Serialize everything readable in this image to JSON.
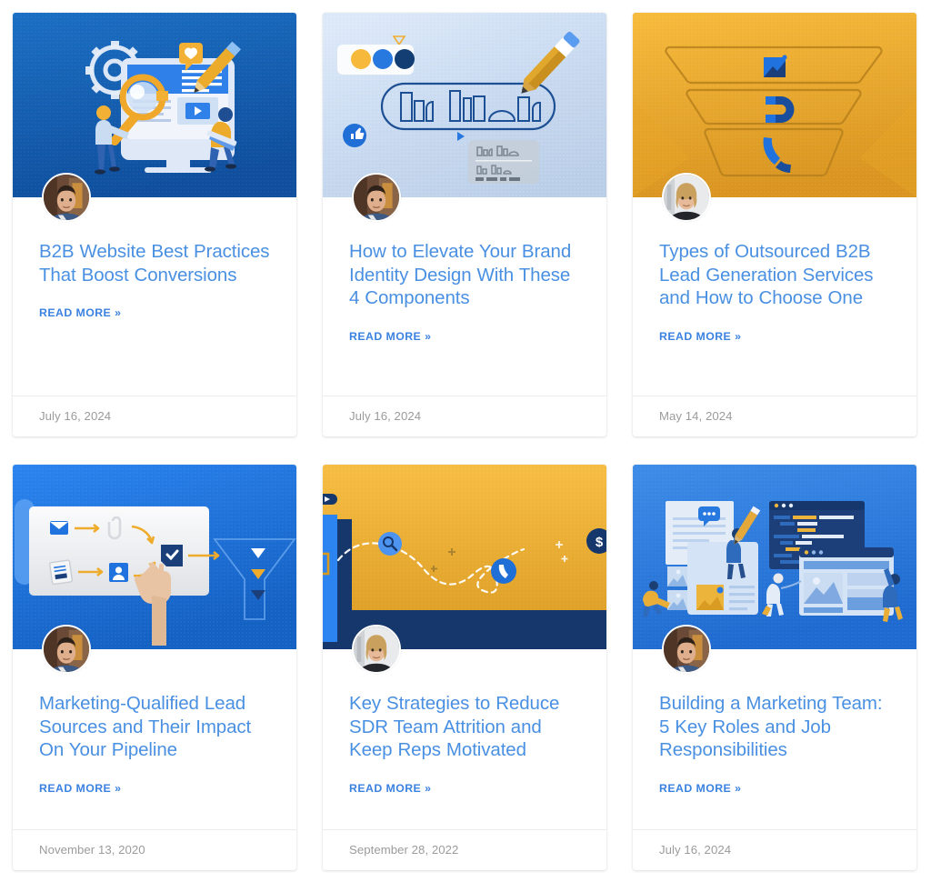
{
  "page": {
    "layout": "blog-post-card-grid",
    "columns": 3,
    "rows": 2,
    "background_color": "#ffffff",
    "title_color": "#4a90e2",
    "link_color": "#3b82e0",
    "date_color": "#9b9b9b",
    "divider_color": "#ececec"
  },
  "common": {
    "read_more_label": "READ MORE",
    "read_more_chevron": "»"
  },
  "cards": [
    {
      "id": "b2b-website-best-practices",
      "title": "B2B Website Best Practices That Boost Conversions",
      "read_more_label": "READ MORE",
      "read_more_chevron": "»",
      "date": "July 16, 2024",
      "author_avatar": "man-in-plaid-shirt-avatar",
      "thumbnail": "website-analysis-illustration",
      "thumbnail_bg": "#1464b4",
      "thumbnail_accent": "#f0ab2e"
    },
    {
      "id": "brand-identity-design",
      "title": "How to Elevate Your Brand Identity Design With These 4 Components",
      "read_more_label": "READ MORE",
      "read_more_chevron": "»",
      "date": "July 16, 2024",
      "author_avatar": "man-in-plaid-shirt-avatar",
      "thumbnail": "brand-identity-palette-illustration",
      "thumbnail_bg": "#cfe0f4",
      "thumbnail_accent": "#f2b134"
    },
    {
      "id": "outsourced-lead-generation",
      "title": "Types of Outsourced B2B Lead Generation Services and How to Choose One",
      "read_more_label": "READ MORE",
      "read_more_chevron": "»",
      "date": "May 14, 2024",
      "author_avatar": "blonde-woman-avatar",
      "thumbnail": "sales-funnel-illustration",
      "thumbnail_bg": "#f5b62e",
      "thumbnail_accent": "#1a68d8"
    },
    {
      "id": "marketing-qualified-lead-sources",
      "title": "Marketing-Qualified Lead Sources and Their Impact On Your Pipeline",
      "read_more_label": "READ MORE",
      "read_more_chevron": "»",
      "date": "November 13, 2020",
      "author_avatar": "man-in-plaid-shirt-avatar",
      "thumbnail": "lead-workflow-funnel-illustration",
      "thumbnail_bg": "#2079e8",
      "thumbnail_accent": "#eeab2c"
    },
    {
      "id": "reduce-sdr-team-attrition",
      "title": "Key Strategies to Reduce SDR Team Attrition and Keep Reps Motivated",
      "read_more_label": "READ MORE",
      "read_more_chevron": "»",
      "date": "September 28, 2022",
      "author_avatar": "blonde-woman-avatar",
      "thumbnail": "sdr-journey-path-illustration",
      "thumbnail_bg": "#f4b637",
      "thumbnail_accent": "#16376b"
    },
    {
      "id": "building-a-marketing-team",
      "title": "Building a Marketing Team: 5 Key Roles and Job Responsibilities",
      "read_more_label": "READ MORE",
      "read_more_chevron": "»",
      "date": "July 16, 2024",
      "author_avatar": "man-in-plaid-shirt-avatar",
      "thumbnail": "marketing-team-workspace-illustration",
      "thumbnail_bg": "#2d7de0",
      "thumbnail_accent": "#1d3f79"
    }
  ]
}
